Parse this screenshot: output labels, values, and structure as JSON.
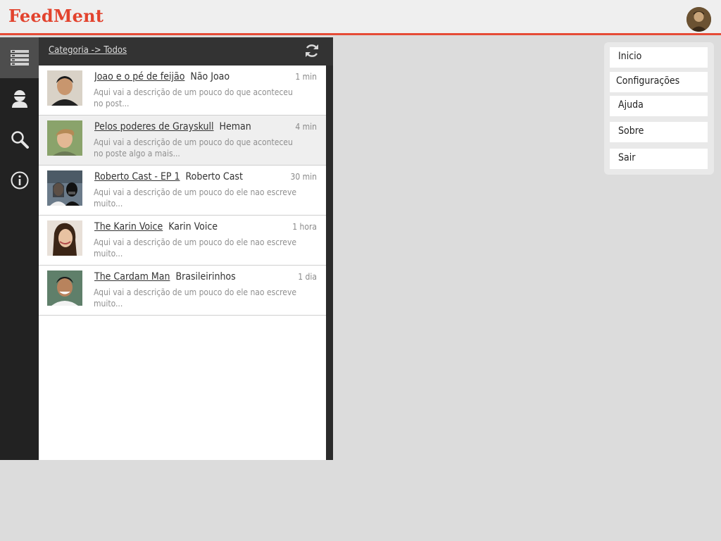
{
  "app": {
    "title": "FeedMent"
  },
  "header": {
    "avatar_icon": "user-avatar"
  },
  "rail": {
    "items": [
      {
        "icon": "list-icon",
        "active": true
      },
      {
        "icon": "user-icon",
        "active": false
      },
      {
        "icon": "search-icon",
        "active": false
      },
      {
        "icon": "info-icon",
        "active": false
      }
    ]
  },
  "panel": {
    "breadcrumb": "Categoria -> Todos",
    "refresh_icon": "refresh-icon"
  },
  "feed": {
    "items": [
      {
        "title": "Joao e o pé de feijão",
        "author": "Não Joao",
        "time": "1 min",
        "desc": "Aqui vai a descrição de um pouco do que aconteceu no post..."
      },
      {
        "title": "Pelos poderes de Grayskull",
        "author": "Heman",
        "time": "4 min",
        "desc": "Aqui vai a descrição de um pouco do que aconteceu no poste algo a mais..."
      },
      {
        "title": "Roberto Cast - EP 1",
        "author": "Roberto Cast",
        "time": "30 min",
        "desc": "Aqui vai a descrição de um pouco do ele nao escreve muito..."
      },
      {
        "title": "The Karin Voice",
        "author": "Karin Voice",
        "time": "1 hora",
        "desc": "Aqui vai a descrição de um pouco do ele nao escreve muito..."
      },
      {
        "title": "The Cardam Man",
        "author": "Brasileirinhos",
        "time": "1 dia",
        "desc": "Aqui vai a descrição de um pouco do ele nao escreve muito..."
      }
    ]
  },
  "menu": {
    "items": [
      "Inicio",
      "Configurações",
      "Ajuda",
      "Sobre",
      "Sair"
    ]
  },
  "colors": {
    "brand": "#e2432e",
    "header_rule": "#e64b36",
    "rail": "#222222",
    "rail_active": "#4d4d4d"
  }
}
